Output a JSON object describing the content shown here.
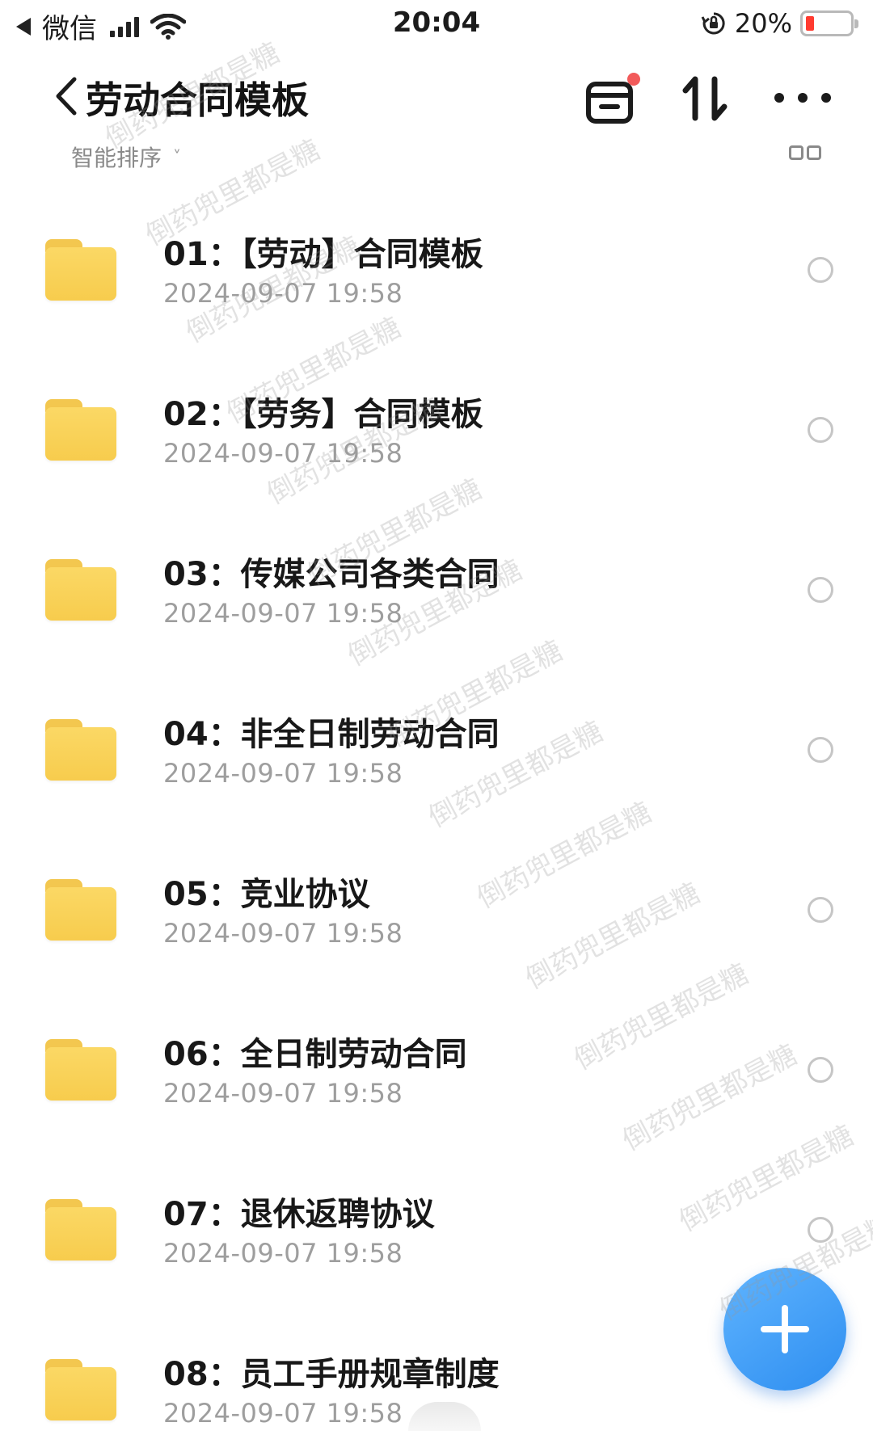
{
  "status_bar": {
    "carrier": "微信",
    "time": "20:04",
    "battery_percent": "20%",
    "battery_color": "#ff3b30"
  },
  "nav": {
    "title": "劳动合同模板",
    "icons": [
      "back-icon",
      "recent-icon",
      "sort-icon",
      "more-icon"
    ],
    "notification_dot_color": "#f25a5a"
  },
  "sort_bar": {
    "label": "智能排序",
    "caret": "˅"
  },
  "files": [
    {
      "title": "01：【劳动】合同模板",
      "date": "2024-09-07 19:58"
    },
    {
      "title": "02：【劳务】合同模板",
      "date": "2024-09-07 19:58"
    },
    {
      "title": "03：传媒公司各类合同",
      "date": "2024-09-07 19:58"
    },
    {
      "title": "04：非全日制劳动合同",
      "date": "2024-09-07 19:58"
    },
    {
      "title": "05：竞业协议",
      "date": "2024-09-07 19:58"
    },
    {
      "title": "06：全日制劳动合同",
      "date": "2024-09-07 19:58"
    },
    {
      "title": "07：退休返聘协议",
      "date": "2024-09-07 19:58"
    },
    {
      "title": "08：员工手册规章制度",
      "date": "2024-09-07 19:58"
    }
  ],
  "fab": {
    "icon": "plus-icon",
    "color": "#2e8ef0"
  },
  "watermark": "倒药兜里都是糖"
}
